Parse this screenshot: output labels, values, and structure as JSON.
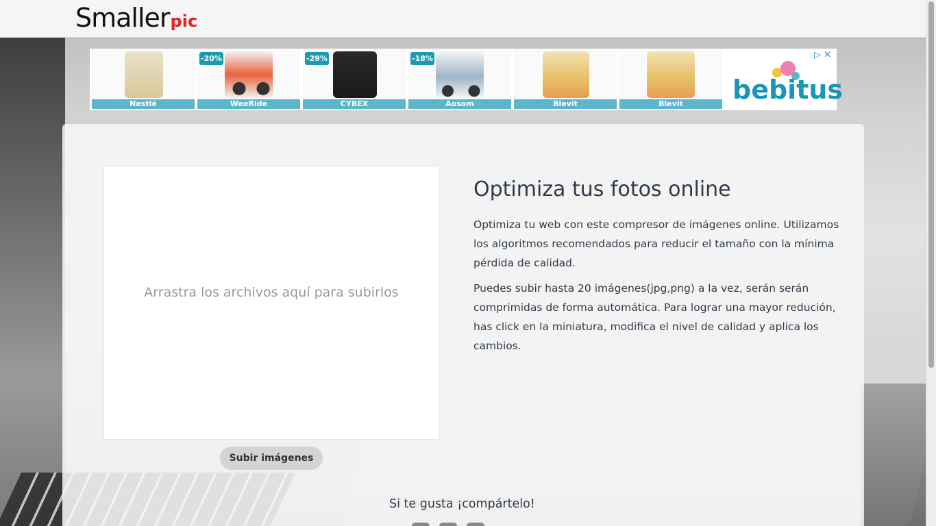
{
  "header": {
    "logo_main": "Smaller",
    "logo_accent": "pic"
  },
  "ad": {
    "items": [
      {
        "label": "Nestlé",
        "discount": "",
        "icon": "cereal-box-icon"
      },
      {
        "label": "WeeRide",
        "discount": "-20%",
        "icon": "bike-trailer-icon"
      },
      {
        "label": "CYBEX",
        "discount": "-29%",
        "icon": "car-seat-icon"
      },
      {
        "label": "Aosom",
        "discount": "-18%",
        "icon": "stroller-icon"
      },
      {
        "label": "Blevit",
        "discount": "",
        "icon": "formula-box-icon"
      },
      {
        "label": "Blevit",
        "discount": "",
        "icon": "formula-box-icon"
      }
    ],
    "brand": "bebitus",
    "choices_icon": "adchoices-icon"
  },
  "dropzone": {
    "text": "Arrastra los archivos aquí para subirlos"
  },
  "upload_button": "Subir imágenes",
  "info": {
    "title": "Optimiza tus fotos online",
    "paragraph1": "Optimiza tu web con este compresor de imágenes online. Utilizamos los algoritmos recomendados para reducir el tamaño con la mínima pérdida de calidad.",
    "paragraph2": "Puedes subir hasta 20 imágenes(jpg,png) a la vez, serán serán comprimidas de forma automática. Para lograr una mayor redución, has click en la miniatura, modifica el nivel de calidad y aplica los cambios."
  },
  "share": {
    "text": "Si te gusta ¡compártelo!"
  },
  "colors": {
    "accent_red": "#e52222",
    "ad_teal": "#5ab6c8",
    "text_dark": "#2d3b4a"
  }
}
